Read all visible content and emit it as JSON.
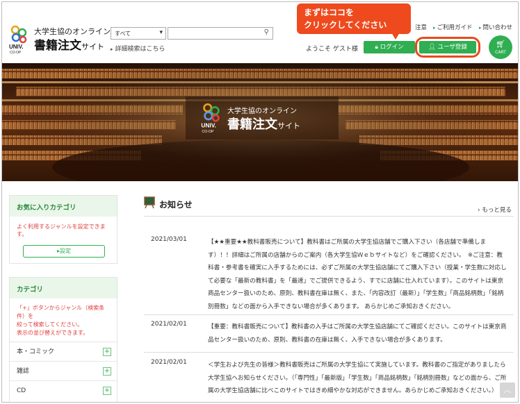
{
  "callout": {
    "line1": "まずはココを",
    "line2": "クリックしてください"
  },
  "header": {
    "logo_sub": "大学生協のオンライン",
    "logo_main": "書籍注文",
    "logo_main_suffix": "サイト",
    "logo_univ": "UNIV.",
    "logo_coop": "CO-OP",
    "search_scope": "すべて",
    "search_placeholder": "",
    "advanced_search": "詳細検索はこちら",
    "links": {
      "notice": "注意",
      "guide": "ご利用ガイド",
      "contact": "問い合わせ"
    },
    "welcome": "ようこそ ゲスト様",
    "login": "ログイン",
    "register": "ユーザ登録",
    "cart": "CART"
  },
  "hero": {
    "logo_sub": "大学生協のオンライン",
    "logo_main": "書籍注文",
    "logo_main_suffix": "サイト",
    "logo_univ": "UNIV.",
    "logo_coop": "CO-OP"
  },
  "sidebar": {
    "favorites": {
      "title": "お気に入りカテゴリ",
      "text": "よく利用するジャンルを設定できます。",
      "button": "▸設定"
    },
    "categories": {
      "title": "カテゴリ",
      "note": [
        "「+」ボタンからジャンル（検索条件）を",
        "絞って検索してください。",
        "表示の並び替えができます。"
      ],
      "items": [
        "本・コミック",
        "雑誌",
        "CD"
      ]
    }
  },
  "news": {
    "title": "お知らせ",
    "more": "もっと見る",
    "items": [
      {
        "date": "2021/03/01",
        "body": "【★★重要★★教科書販売について】教科書はご所属の大学生協店舗でご購入下さい（各店舗で準備します）！！詳細はご所属の店舗からのご案内（各大学生協Ｗｅｂサイトなど）をご確認ください。　※ご注意：教科書・参考書を確実に入手するためには、必ずご所属の大学生協店舗にてご購入下さい（授業・学生数に対応して必要な「最新の教科書」を「最速」でご提供できるよう、すでに店舗に仕入れています）。このサイトは東京商品センター扱いのため、原則、教科書在庫は無く、また、「内容改訂（最新）」「学生数」「商品銘柄数」「銘柄別冊数」などの面から入手できない場合が多くあります。 あらかじめご承知おきください。"
      },
      {
        "date": "2021/02/01",
        "body": "【重要：教科書販売について】教科書の入手はご所属の大学生協店舗にてご確認ください。このサイトは東京商品センター扱いのため、原則、教科書の在庫は無く、入手できない場合が多くあります。"
      },
      {
        "date": "2021/02/01",
        "body": "＜学生および先生の皆様＞教科書販売はご所属の大学生協にて実施しています。教科書のご指定がありましたら大学生協へお知らせください。（「専門性」「最新版」「学生数」「商品銘柄数」「銘柄別冊数」などの面から、ご所属の大学生協店舗に比べこのサイトではきめ細やかな対応ができません。あらかじめご承知おきください。）"
      }
    ]
  }
}
